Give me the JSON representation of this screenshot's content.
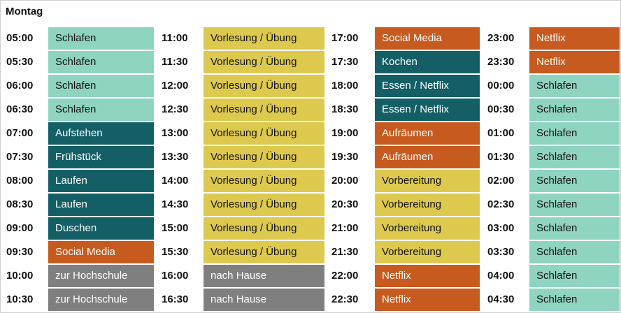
{
  "title": "Montag",
  "colors": {
    "sleep": "#8fd4c1",
    "teal": "#145f66",
    "orange": "#c75a1e",
    "yellow": "#dec94f",
    "gray": "#7f7f7f"
  },
  "columns": [
    {
      "slots": [
        {
          "time": "05:00",
          "activity": "Schlafen",
          "color": "sleep"
        },
        {
          "time": "05:30",
          "activity": "Schlafen",
          "color": "sleep"
        },
        {
          "time": "06:00",
          "activity": "Schlafen",
          "color": "sleep"
        },
        {
          "time": "06:30",
          "activity": "Schlafen",
          "color": "sleep"
        },
        {
          "time": "07:00",
          "activity": "Aufstehen",
          "color": "teal"
        },
        {
          "time": "07:30",
          "activity": "Frühstück",
          "color": "teal"
        },
        {
          "time": "08:00",
          "activity": "Laufen",
          "color": "teal"
        },
        {
          "time": "08:30",
          "activity": "Laufen",
          "color": "teal"
        },
        {
          "time": "09:00",
          "activity": "Duschen",
          "color": "teal"
        },
        {
          "time": "09:30",
          "activity": "Social Media",
          "color": "orange"
        },
        {
          "time": "10:00",
          "activity": "zur Hochschule",
          "color": "gray"
        },
        {
          "time": "10:30",
          "activity": "zur Hochschule",
          "color": "gray"
        }
      ]
    },
    {
      "slots": [
        {
          "time": "11:00",
          "activity": "Vorlesung / Übung",
          "color": "yellow"
        },
        {
          "time": "11:30",
          "activity": "Vorlesung / Übung",
          "color": "yellow"
        },
        {
          "time": "12:00",
          "activity": "Vorlesung / Übung",
          "color": "yellow"
        },
        {
          "time": "12:30",
          "activity": "Vorlesung / Übung",
          "color": "yellow"
        },
        {
          "time": "13:00",
          "activity": "Vorlesung / Übung",
          "color": "yellow"
        },
        {
          "time": "13:30",
          "activity": "Vorlesung / Übung",
          "color": "yellow"
        },
        {
          "time": "14:00",
          "activity": "Vorlesung / Übung",
          "color": "yellow"
        },
        {
          "time": "14:30",
          "activity": "Vorlesung / Übung",
          "color": "yellow"
        },
        {
          "time": "15:00",
          "activity": "Vorlesung / Übung",
          "color": "yellow"
        },
        {
          "time": "15:30",
          "activity": "Vorlesung / Übung",
          "color": "yellow"
        },
        {
          "time": "16:00",
          "activity": "nach Hause",
          "color": "gray"
        },
        {
          "time": "16:30",
          "activity": "nach Hause",
          "color": "gray"
        }
      ]
    },
    {
      "slots": [
        {
          "time": "17:00",
          "activity": "Social Media",
          "color": "orange"
        },
        {
          "time": "17:30",
          "activity": "Kochen",
          "color": "teal"
        },
        {
          "time": "18:00",
          "activity": "Essen / Netflix",
          "color": "teal"
        },
        {
          "time": "18:30",
          "activity": "Essen / Netflix",
          "color": "teal"
        },
        {
          "time": "19:00",
          "activity": "Aufräumen",
          "color": "orange"
        },
        {
          "time": "19:30",
          "activity": "Aufräumen",
          "color": "orange"
        },
        {
          "time": "20:00",
          "activity": "Vorbereitung",
          "color": "yellow"
        },
        {
          "time": "20:30",
          "activity": "Vorbereitung",
          "color": "yellow"
        },
        {
          "time": "21:00",
          "activity": "Vorbereitung",
          "color": "yellow"
        },
        {
          "time": "21:30",
          "activity": "Vorbereitung",
          "color": "yellow"
        },
        {
          "time": "22:00",
          "activity": "Netflix",
          "color": "orange"
        },
        {
          "time": "22:30",
          "activity": "Netflix",
          "color": "orange"
        }
      ]
    },
    {
      "slots": [
        {
          "time": "23:00",
          "activity": "Netflix",
          "color": "orange"
        },
        {
          "time": "23:30",
          "activity": "Netflix",
          "color": "orange"
        },
        {
          "time": "00:00",
          "activity": "Schlafen",
          "color": "sleep"
        },
        {
          "time": "00:30",
          "activity": "Schlafen",
          "color": "sleep"
        },
        {
          "time": "01:00",
          "activity": "Schlafen",
          "color": "sleep"
        },
        {
          "time": "01:30",
          "activity": "Schlafen",
          "color": "sleep"
        },
        {
          "time": "02:00",
          "activity": "Schlafen",
          "color": "sleep"
        },
        {
          "time": "02:30",
          "activity": "Schlafen",
          "color": "sleep"
        },
        {
          "time": "03:00",
          "activity": "Schlafen",
          "color": "sleep"
        },
        {
          "time": "03:30",
          "activity": "Schlafen",
          "color": "sleep"
        },
        {
          "time": "04:00",
          "activity": "Schlafen",
          "color": "sleep"
        },
        {
          "time": "04:30",
          "activity": "Schlafen",
          "color": "sleep"
        }
      ]
    }
  ]
}
